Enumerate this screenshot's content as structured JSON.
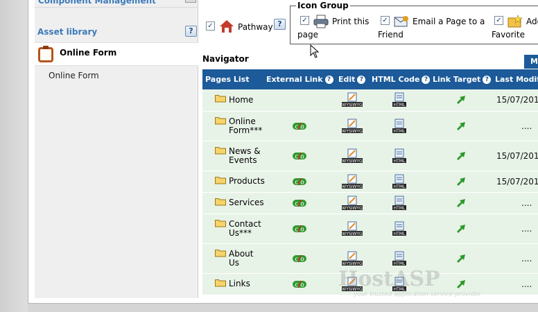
{
  "sidebar": {
    "top_title": "Component Management",
    "asset_library_title": "Asset library",
    "asset_item_label": "Online Form",
    "sub_item_label": "Online Form"
  },
  "options": {
    "pathway_label": "Pathway",
    "icon_group_legend": "Icon Group",
    "print_label_1": "Print this",
    "print_label_2": "page",
    "email_label_1": "Email a Page to a",
    "email_label_2": "Friend",
    "favorite_label_1": "Add",
    "favorite_label_2": "Favorite",
    "help": "?"
  },
  "navigator": {
    "title": "Navigator",
    "tab_stub": "M",
    "columns": [
      "Pages List",
      "External Link",
      "Edit",
      "HTML Code",
      "Link Target",
      "Last Modifi"
    ],
    "rows": [
      {
        "page": "Home",
        "external": false,
        "modified": "15/07/201"
      },
      {
        "page": "Online Form***",
        "external": true,
        "modified": "...."
      },
      {
        "page": "News & Events",
        "external": true,
        "modified": "15/07/201"
      },
      {
        "page": "Products",
        "external": true,
        "modified": "15/07/201"
      },
      {
        "page": "Services",
        "external": true,
        "modified": "...."
      },
      {
        "page": "Contact Us***",
        "external": true,
        "modified": "...."
      },
      {
        "page": "About Us",
        "external": true,
        "modified": "...."
      },
      {
        "page": "Links",
        "external": true,
        "modified": "...."
      }
    ],
    "edit_icon_label": "WYSIWYG",
    "html_icon_label": "HTML"
  },
  "watermark": {
    "main": "HostASP",
    "sub": "your trusted application service provider"
  },
  "colors": {
    "header_blue": "#1c5a99",
    "row_green": "#e8f3e8",
    "sidebar_title": "#3d7ab8"
  }
}
